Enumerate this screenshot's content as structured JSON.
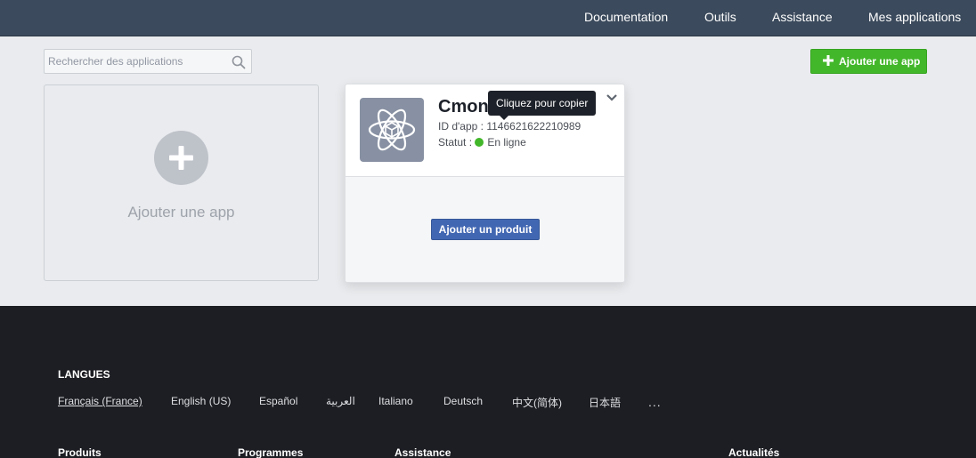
{
  "nav": {
    "items": [
      "Documentation",
      "Outils",
      "Assistance",
      "Mes applications"
    ]
  },
  "search": {
    "placeholder": "Rechercher des applications",
    "icon": "search-icon"
  },
  "toolbar": {
    "add_app_label": "Ajouter une app",
    "accent": "#42b72a"
  },
  "add_tile": {
    "label": "Ajouter une app"
  },
  "app": {
    "name": "Cmon",
    "id_label": "ID d'app :",
    "id_value": "1146621622210989",
    "status_label": "Statut :",
    "status_value": "En ligne",
    "status_color": "#42b72a",
    "add_product_label": "Ajouter un produit",
    "tooltip": "Cliquez pour copier"
  },
  "footer": {
    "languages_heading": "LANGUES",
    "languages": [
      "Français (France)",
      "English (US)",
      "Español",
      "العربية",
      "Italiano",
      "Deutsch",
      "中文(简体)",
      "日本語"
    ],
    "more": "...",
    "columns": [
      "Produits",
      "Programmes",
      "Assistance",
      "Actualités"
    ]
  }
}
